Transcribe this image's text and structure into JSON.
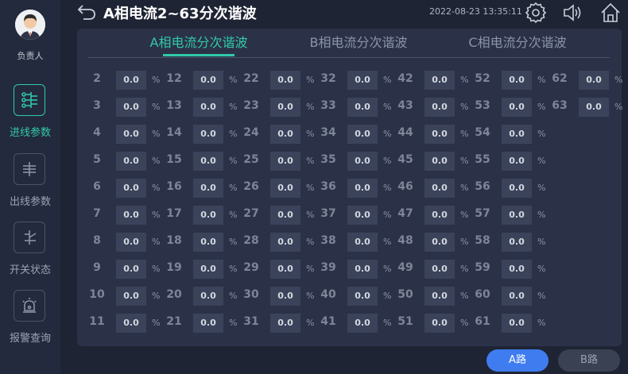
{
  "sidebar": {
    "avatar_label": "负责人",
    "items": [
      {
        "label": "进线参数",
        "icon": "incoming-params-icon",
        "active": true
      },
      {
        "label": "出线参数",
        "icon": "outgoing-params-icon",
        "active": false
      },
      {
        "label": "开关状态",
        "icon": "switch-status-icon",
        "active": false
      },
      {
        "label": "报警查询",
        "icon": "alarm-query-icon",
        "active": false
      }
    ]
  },
  "header": {
    "title": "A相电流2~63分次谐波",
    "datetime": "2022-08-23 13:35:11"
  },
  "tabs": [
    {
      "label": "A相电流分次谐波",
      "active": true
    },
    {
      "label": "B相电流分次谐波",
      "active": false
    },
    {
      "label": "C相电流分次谐波",
      "active": false
    }
  ],
  "harmonics": {
    "unit": "%",
    "columns": [
      [
        {
          "n": "2",
          "v": "0.0"
        },
        {
          "n": "3",
          "v": "0.0"
        },
        {
          "n": "4",
          "v": "0.0"
        },
        {
          "n": "5",
          "v": "0.0"
        },
        {
          "n": "6",
          "v": "0.0"
        },
        {
          "n": "7",
          "v": "0.0"
        },
        {
          "n": "8",
          "v": "0.0"
        },
        {
          "n": "9",
          "v": "0.0"
        },
        {
          "n": "10",
          "v": "0.0"
        },
        {
          "n": "11",
          "v": "0.0"
        }
      ],
      [
        {
          "n": "12",
          "v": "0.0"
        },
        {
          "n": "13",
          "v": "0.0"
        },
        {
          "n": "14",
          "v": "0.0"
        },
        {
          "n": "15",
          "v": "0.0"
        },
        {
          "n": "16",
          "v": "0.0"
        },
        {
          "n": "17",
          "v": "0.0"
        },
        {
          "n": "18",
          "v": "0.0"
        },
        {
          "n": "19",
          "v": "0.0"
        },
        {
          "n": "20",
          "v": "0.0"
        },
        {
          "n": "21",
          "v": "0.0"
        }
      ],
      [
        {
          "n": "22",
          "v": "0.0"
        },
        {
          "n": "23",
          "v": "0.0"
        },
        {
          "n": "24",
          "v": "0.0"
        },
        {
          "n": "25",
          "v": "0.0"
        },
        {
          "n": "26",
          "v": "0.0"
        },
        {
          "n": "27",
          "v": "0.0"
        },
        {
          "n": "28",
          "v": "0.0"
        },
        {
          "n": "29",
          "v": "0.0"
        },
        {
          "n": "30",
          "v": "0.0"
        },
        {
          "n": "31",
          "v": "0.0"
        }
      ],
      [
        {
          "n": "32",
          "v": "0.0"
        },
        {
          "n": "33",
          "v": "0.0"
        },
        {
          "n": "34",
          "v": "0.0"
        },
        {
          "n": "35",
          "v": "0.0"
        },
        {
          "n": "36",
          "v": "0.0"
        },
        {
          "n": "37",
          "v": "0.0"
        },
        {
          "n": "38",
          "v": "0.0"
        },
        {
          "n": "39",
          "v": "0.0"
        },
        {
          "n": "40",
          "v": "0.0"
        },
        {
          "n": "41",
          "v": "0.0"
        }
      ],
      [
        {
          "n": "42",
          "v": "0.0"
        },
        {
          "n": "43",
          "v": "0.0"
        },
        {
          "n": "44",
          "v": "0.0"
        },
        {
          "n": "45",
          "v": "0.0"
        },
        {
          "n": "46",
          "v": "0.0"
        },
        {
          "n": "47",
          "v": "0.0"
        },
        {
          "n": "48",
          "v": "0.0"
        },
        {
          "n": "49",
          "v": "0.0"
        },
        {
          "n": "50",
          "v": "0.0"
        },
        {
          "n": "51",
          "v": "0.0"
        }
      ],
      [
        {
          "n": "52",
          "v": "0.0"
        },
        {
          "n": "53",
          "v": "0.0"
        },
        {
          "n": "54",
          "v": "0.0"
        },
        {
          "n": "55",
          "v": "0.0"
        },
        {
          "n": "56",
          "v": "0.0"
        },
        {
          "n": "57",
          "v": "0.0"
        },
        {
          "n": "58",
          "v": "0.0"
        },
        {
          "n": "59",
          "v": "0.0"
        },
        {
          "n": "60",
          "v": "0.0"
        },
        {
          "n": "61",
          "v": "0.0"
        }
      ],
      [
        {
          "n": "62",
          "v": "0.0"
        },
        {
          "n": "63",
          "v": "0.0"
        }
      ]
    ]
  },
  "footer": {
    "route_a": "A路",
    "route_b": "B路"
  },
  "colors": {
    "accent": "#31c9a9",
    "primary_button": "#3f7cf0",
    "background": "#1f2434",
    "panel": "#2b3247"
  }
}
